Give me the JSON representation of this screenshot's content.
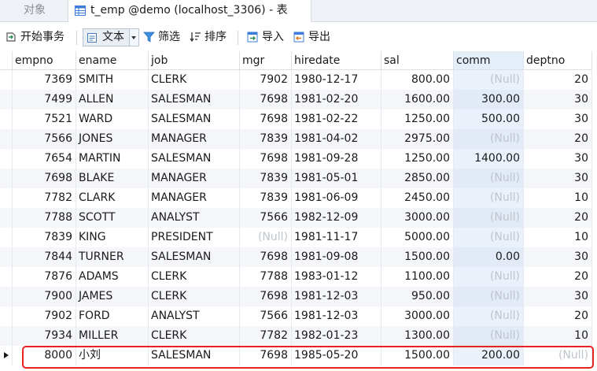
{
  "tabs": {
    "objects_label": "对象",
    "active_label": "t_emp @demo (localhost_3306) - 表"
  },
  "toolbar": {
    "begin_transaction": "开始事务",
    "text": "文本",
    "filter": "筛选",
    "sort": "排序",
    "import": "导入",
    "export": "导出"
  },
  "table": {
    "columns": [
      "empno",
      "ename",
      "job",
      "mgr",
      "hiredate",
      "sal",
      "comm",
      "deptno"
    ],
    "rows": [
      [
        "7369",
        "SMITH",
        "CLERK",
        "7902",
        "1980-12-17",
        "800.00",
        "(Null)",
        "20"
      ],
      [
        "7499",
        "ALLEN",
        "SALESMAN",
        "7698",
        "1981-02-20",
        "1600.00",
        "300.00",
        "30"
      ],
      [
        "7521",
        "WARD",
        "SALESMAN",
        "7698",
        "1981-02-22",
        "1250.00",
        "500.00",
        "30"
      ],
      [
        "7566",
        "JONES",
        "MANAGER",
        "7839",
        "1981-04-02",
        "2975.00",
        "(Null)",
        "20"
      ],
      [
        "7654",
        "MARTIN",
        "SALESMAN",
        "7698",
        "1981-09-28",
        "1250.00",
        "1400.00",
        "30"
      ],
      [
        "7698",
        "BLAKE",
        "MANAGER",
        "7839",
        "1981-05-01",
        "2850.00",
        "(Null)",
        "30"
      ],
      [
        "7782",
        "CLARK",
        "MANAGER",
        "7839",
        "1981-06-09",
        "2450.00",
        "(Null)",
        "10"
      ],
      [
        "7788",
        "SCOTT",
        "ANALYST",
        "7566",
        "1982-12-09",
        "3000.00",
        "(Null)",
        "20"
      ],
      [
        "7839",
        "KING",
        "PRESIDENT",
        "(Null)",
        "1981-11-17",
        "5000.00",
        "(Null)",
        "10"
      ],
      [
        "7844",
        "TURNER",
        "SALESMAN",
        "7698",
        "1981-09-08",
        "1500.00",
        "0.00",
        "30"
      ],
      [
        "7876",
        "ADAMS",
        "CLERK",
        "7788",
        "1983-01-12",
        "1100.00",
        "(Null)",
        "20"
      ],
      [
        "7900",
        "JAMES",
        "CLERK",
        "7698",
        "1981-12-03",
        "950.00",
        "(Null)",
        "30"
      ],
      [
        "7902",
        "FORD",
        "ANALYST",
        "7566",
        "1981-12-03",
        "3000.00",
        "(Null)",
        "20"
      ],
      [
        "7934",
        "MILLER",
        "CLERK",
        "7782",
        "1982-01-23",
        "1300.00",
        "(Null)",
        "10"
      ],
      [
        "8000",
        "小刘",
        "SALESMAN",
        "7698",
        "1985-05-20",
        "1500.00",
        "200.00",
        "(Null)"
      ]
    ],
    "current_row_index": 14,
    "highlighted_column": "comm",
    "highlight_color": "#e8221f"
  }
}
